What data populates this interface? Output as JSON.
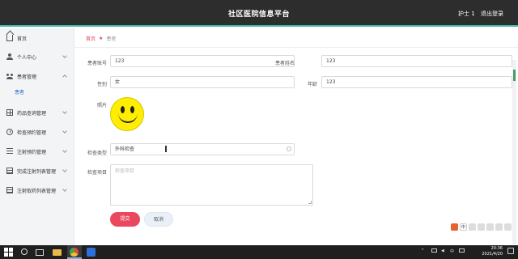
{
  "header": {
    "title": "社区医院信息平台",
    "user_label": "护士 1",
    "logout_label": "退出登录"
  },
  "sidebar": {
    "items": [
      {
        "label": "首页",
        "icon": "home-icon"
      },
      {
        "label": "个人中心",
        "icon": "user-icon",
        "expandable": true
      },
      {
        "label": "患者管理",
        "icon": "group-icon",
        "expandable": true,
        "expanded": true
      },
      {
        "label": "药品查询管理",
        "icon": "grid-icon",
        "expandable": true
      },
      {
        "label": "检查预约管理",
        "icon": "clock-icon",
        "expandable": true
      },
      {
        "label": "注射预约管理",
        "icon": "list-icon",
        "expandable": true
      },
      {
        "label": "完成注射列表管理",
        "icon": "doc-icon",
        "expandable": true
      },
      {
        "label": "注射取药列表管理",
        "icon": "doc-icon",
        "expandable": true
      }
    ],
    "sub_item": "患者"
  },
  "breadcrumb": {
    "home": "首页",
    "current": "患者"
  },
  "form": {
    "account_label": "患者账号",
    "account_value": "123",
    "name_label": "患者姓名",
    "name_value": "123",
    "gender_label": "性别",
    "gender_value": "女",
    "age_label": "年龄",
    "age_value": "123",
    "photo_label": "照片",
    "exam_type_label": "检查类型",
    "exam_type_value": "外科检查",
    "exam_item_label": "检查项目",
    "exam_item_placeholder": "检查项目",
    "submit_label": "提交",
    "cancel_label": "取消"
  },
  "taskbar": {
    "time": "20:36",
    "date": "2021/4/20",
    "ime": "中"
  },
  "colors": {
    "header_bg": "#2d2d2d",
    "accent_teal": "#3fb8a8",
    "primary_red": "#e9485e",
    "sidebar_bg": "#f3f4f6"
  }
}
